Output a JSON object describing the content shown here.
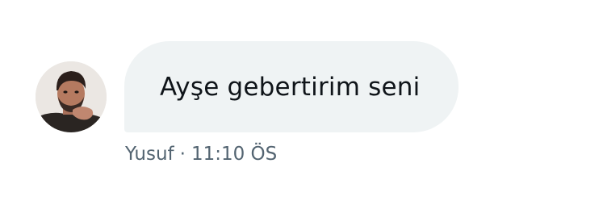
{
  "message": {
    "text": "Ayşe gebertirim seni",
    "sender": "Yusuf",
    "separator": "·",
    "time": "11:10 ÖS"
  },
  "avatar": {
    "icon": "profile-photo"
  },
  "colors": {
    "bubble": "#eff3f4",
    "text": "#0f1419",
    "meta": "#536471"
  }
}
